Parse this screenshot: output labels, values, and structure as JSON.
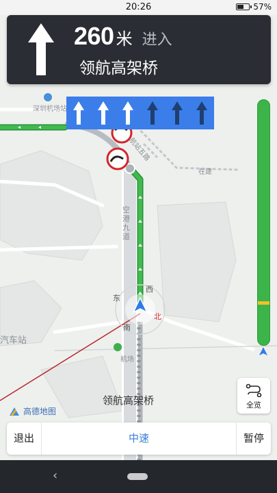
{
  "status_bar": {
    "time": "20:26",
    "battery_percent": "57%",
    "battery_level": 0.57
  },
  "guidance": {
    "maneuver_icon": "straight-arrow-icon",
    "distance": "260",
    "unit": "米",
    "action": "进入",
    "next_road": "领航高架桥"
  },
  "lanes": [
    {
      "icon": "lane-straight-icon",
      "active": true
    },
    {
      "icon": "lane-straight-icon",
      "active": true
    },
    {
      "icon": "lane-straight-icon",
      "active": true
    },
    {
      "icon": "lane-straight-icon",
      "active": false
    },
    {
      "icon": "lane-straight-icon",
      "active": false
    },
    {
      "icon": "lane-straight-icon",
      "active": false
    }
  ],
  "map": {
    "labels": {
      "station": "深圳机场站",
      "road_hangzhan": "航站五路",
      "construction": "在建",
      "konggang": "空港九道",
      "north": "北",
      "south": "南",
      "west": "西",
      "east": "东",
      "bus_station": "汽车站",
      "airport": "机场",
      "current_road": "领航高架桥",
      "logo": "高德地图"
    }
  },
  "route_progress": {
    "traffic_marker_position": 0.82,
    "color_clear": "#3cb44a",
    "color_slow": "#f2c029"
  },
  "overview_button": {
    "label": "全览",
    "icon": "route-overview-icon"
  },
  "bottom_bar": {
    "exit_label": "退出",
    "speed_status": "中速",
    "pause_label": "暂停"
  },
  "nav_bar": {
    "back_icon": "back-chevron-icon",
    "home_icon": "home-pill-icon"
  },
  "colors": {
    "route": "#33b24a",
    "lane_panel": "#3b7eea",
    "guide_card": "#2a2d33",
    "car": "#2e7ae8"
  }
}
